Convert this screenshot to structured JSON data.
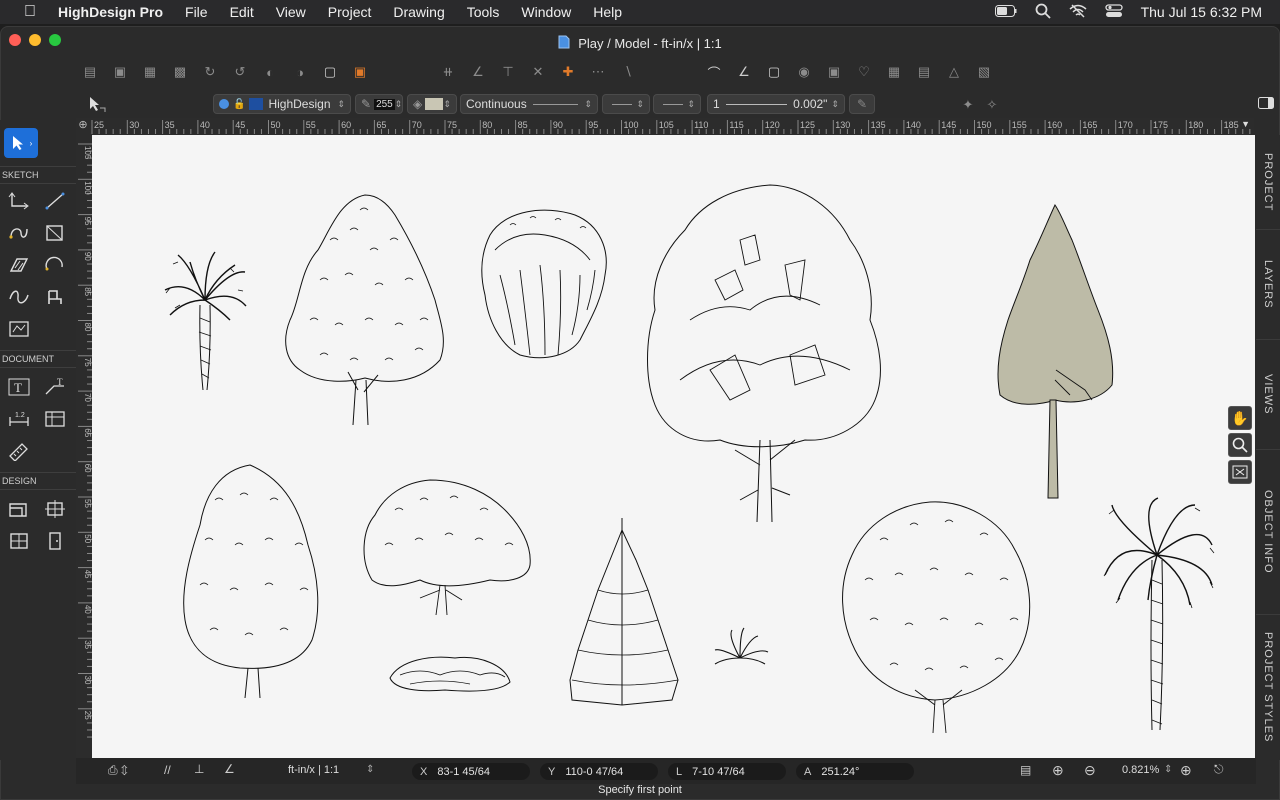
{
  "menubar": {
    "app_name": "HighDesign Pro",
    "items": [
      "File",
      "Edit",
      "View",
      "Project",
      "Drawing",
      "Tools",
      "Window",
      "Help"
    ],
    "clock": "Thu Jul 15  6:32 PM"
  },
  "window": {
    "title": "Play / Model - ft-in/x | 1:1"
  },
  "propbar": {
    "layer": "HighDesign",
    "opacity": "255",
    "linetype": "Continuous",
    "lineweight_value": "1",
    "lineweight": "0.002\""
  },
  "leftbar": {
    "sections": [
      "SKETCH",
      "DOCUMENT",
      "DESIGN"
    ]
  },
  "rulers": {
    "top_labels": [
      "25",
      "30",
      "35",
      "40",
      "45",
      "50",
      "55",
      "60",
      "65",
      "70",
      "75",
      "80",
      "85",
      "90",
      "95",
      "100",
      "105",
      "110",
      "115",
      "120",
      "125",
      "130",
      "135",
      "140",
      "145",
      "150",
      "155",
      "160",
      "165",
      "170",
      "175",
      "180",
      "185"
    ],
    "left_labels": [
      "105",
      "100",
      "95",
      "90",
      "85",
      "80",
      "75",
      "70",
      "65",
      "60",
      "55",
      "50",
      "45",
      "40",
      "35",
      "30",
      "25"
    ]
  },
  "rightbar": {
    "tabs": [
      "PROJECT",
      "LAYERS",
      "VIEWS",
      "OBJECT INFO",
      "PROJECT STYLES"
    ]
  },
  "statusbar": {
    "units": "ft-in/x | 1:1",
    "x_label": "X",
    "x_value": "83-1 45/64",
    "y_label": "Y",
    "y_value": "110-0 47/64",
    "l_label": "L",
    "l_value": "7-10 47/64",
    "a_label": "A",
    "a_value": "251.24°",
    "zoom": "0.821%",
    "hint": "Specify first point"
  },
  "colors": {
    "accent": "#1e6fd9",
    "canvas": "#f5f5f5",
    "tree_fill": "#bdbba7"
  }
}
